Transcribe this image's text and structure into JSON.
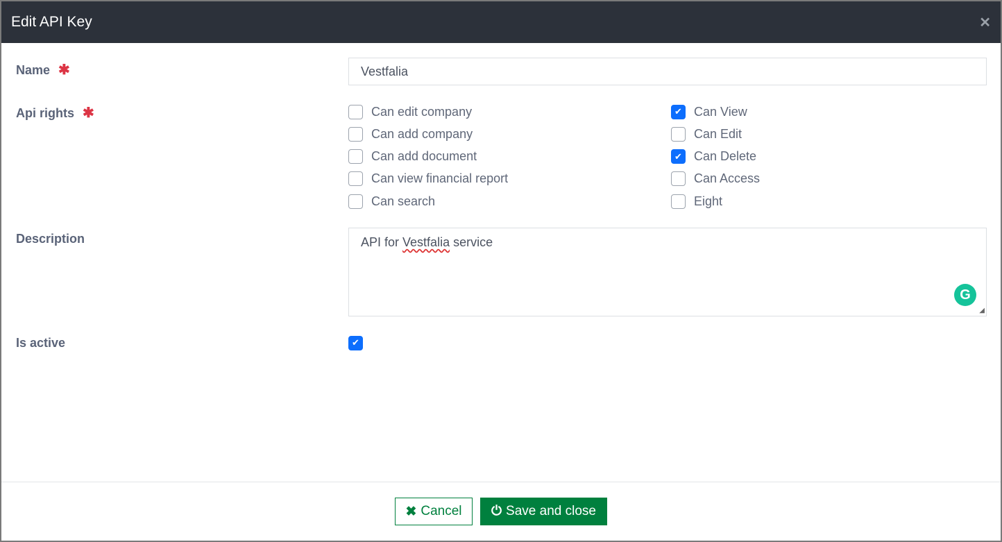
{
  "modal": {
    "title": "Edit API Key",
    "close_icon": "close-icon"
  },
  "form": {
    "name_label": "Name",
    "name_value": "Vestfalia",
    "rights_label": "Api rights",
    "rights": [
      {
        "label": "Can edit company",
        "checked": false
      },
      {
        "label": "Can add company",
        "checked": false
      },
      {
        "label": "Can add document",
        "checked": false
      },
      {
        "label": "Can view financial report",
        "checked": false
      },
      {
        "label": "Can search",
        "checked": false
      },
      {
        "label": "Can View",
        "checked": true
      },
      {
        "label": "Can Edit",
        "checked": false
      },
      {
        "label": "Can Delete",
        "checked": true
      },
      {
        "label": "Can Access",
        "checked": false
      },
      {
        "label": "Eight",
        "checked": false
      }
    ],
    "description_label": "Description",
    "description_pre": "API for ",
    "description_word": "Vestfalia",
    "description_post": " service",
    "active_label": "Is active",
    "active": true,
    "required_mark": "✱"
  },
  "footer": {
    "cancel": "Cancel",
    "save": "Save and close"
  },
  "colors": {
    "accent": "#00803e",
    "check": "#0d6efd",
    "header": "#2c313a",
    "required": "#dc3545"
  }
}
